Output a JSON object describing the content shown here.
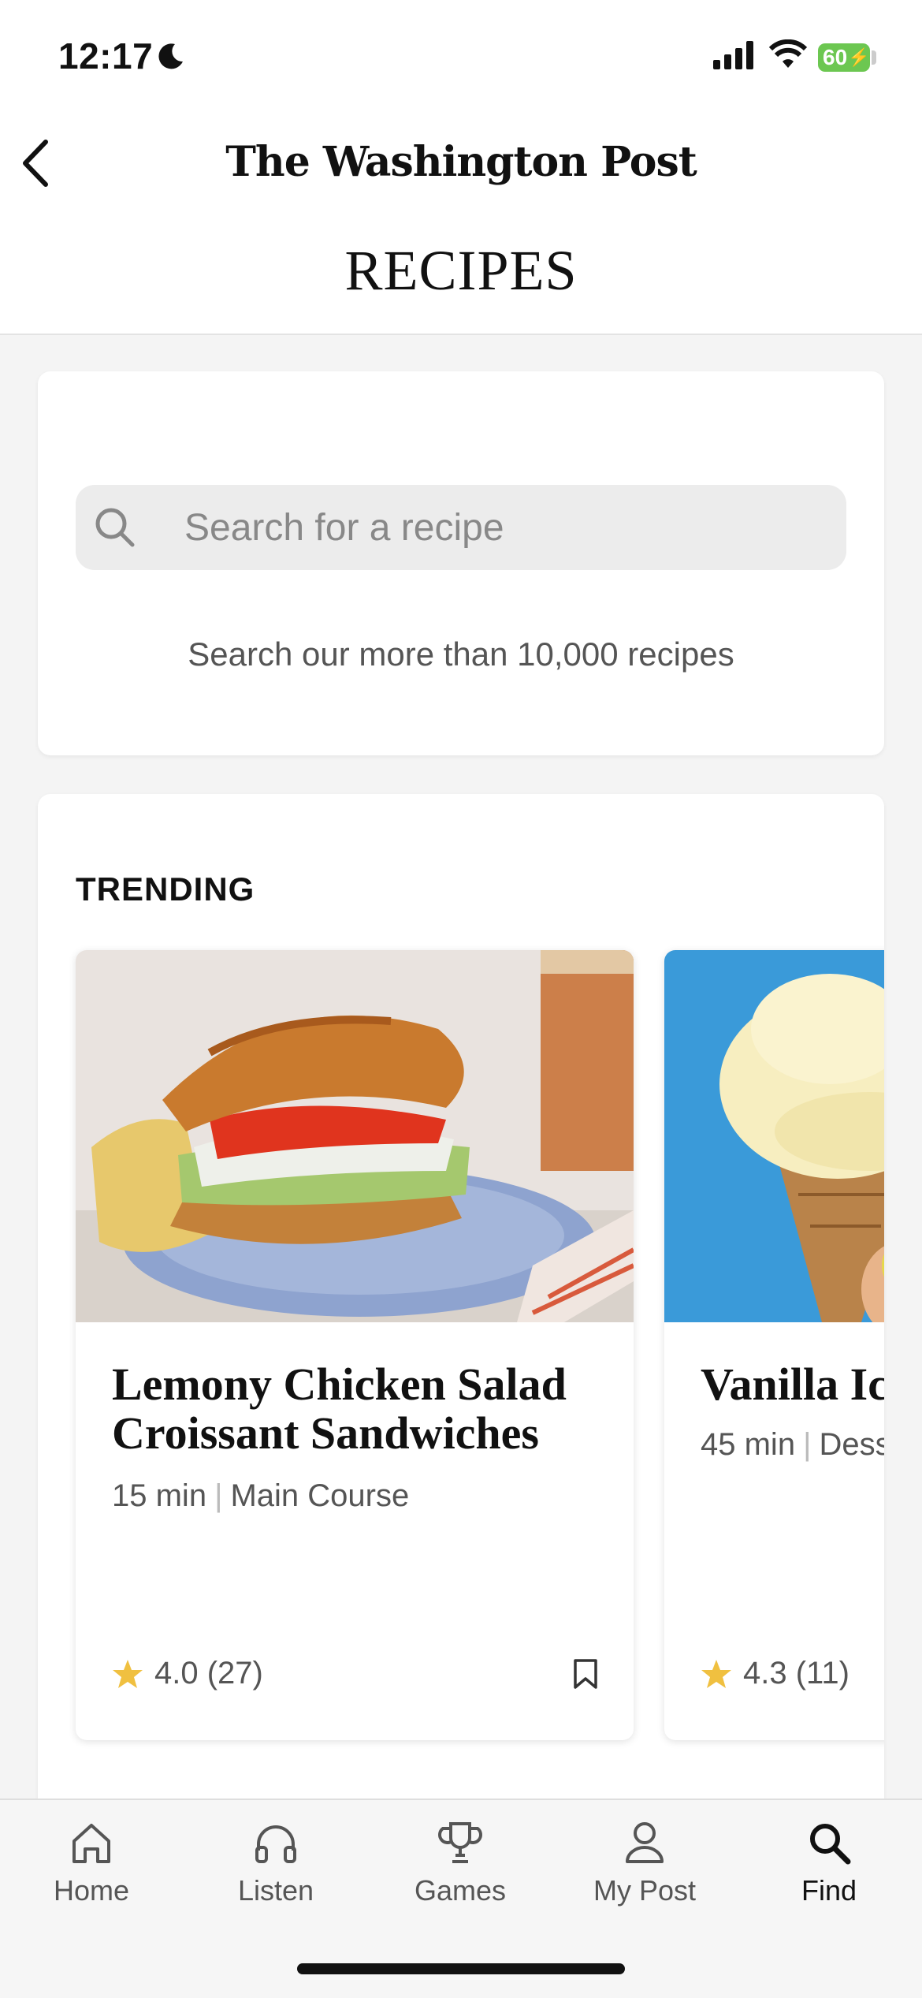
{
  "status_bar": {
    "time": "12:17",
    "battery": "60"
  },
  "header": {
    "logo": "The Washington Post",
    "title": "RECIPES"
  },
  "search": {
    "placeholder": "Search for a recipe",
    "subtitle": "Search our more than 10,000 recipes"
  },
  "trending": {
    "title": "TRENDING",
    "recipes": [
      {
        "name": "Lemony Chicken Salad Croissant Sandwiches",
        "time": "15 min",
        "category": "Main Course",
        "rating": "4.0",
        "reviews": "(27)",
        "rating_value": 4.0
      },
      {
        "name": "Vanilla Ice Cream",
        "time": "45 min",
        "category": "Dessert",
        "rating": "4.3",
        "reviews": "(11)",
        "rating_value": 4.3
      }
    ]
  },
  "tabbar": {
    "items": [
      {
        "label": "Home",
        "icon": "home-icon"
      },
      {
        "label": "Listen",
        "icon": "headphones-icon"
      },
      {
        "label": "Games",
        "icon": "trophy-icon"
      },
      {
        "label": "My Post",
        "icon": "person-icon"
      },
      {
        "label": "Find",
        "icon": "search-icon"
      }
    ],
    "active": "Find"
  },
  "colors": {
    "accent_star": "#f0c040",
    "battery_green": "#6cc751",
    "ice_cream_bg": "#3a9ad9"
  }
}
